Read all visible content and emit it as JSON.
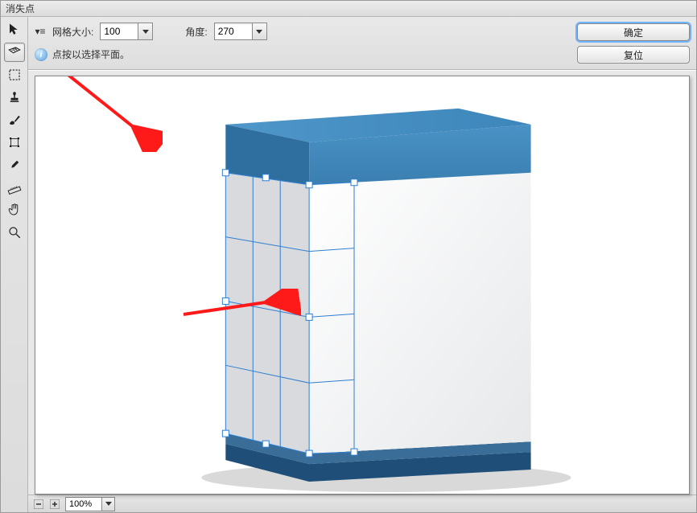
{
  "window": {
    "title": "消失点"
  },
  "options": {
    "grid_label": "网格大小:",
    "grid_value": "100",
    "angle_label": "角度:",
    "angle_value": "270",
    "info_text": "点按以选择平面。"
  },
  "buttons": {
    "ok": "确定",
    "reset": "复位"
  },
  "status": {
    "zoom": "100%"
  },
  "tools": [
    {
      "name": "edit-plane-tool"
    },
    {
      "name": "create-plane-tool"
    },
    {
      "name": "marquee-tool"
    },
    {
      "name": "stamp-tool"
    },
    {
      "name": "brush-tool"
    },
    {
      "name": "transform-tool"
    },
    {
      "name": "eyedropper-tool"
    },
    {
      "name": "measure-tool"
    },
    {
      "name": "hand-tool"
    },
    {
      "name": "zoom-tool"
    }
  ]
}
